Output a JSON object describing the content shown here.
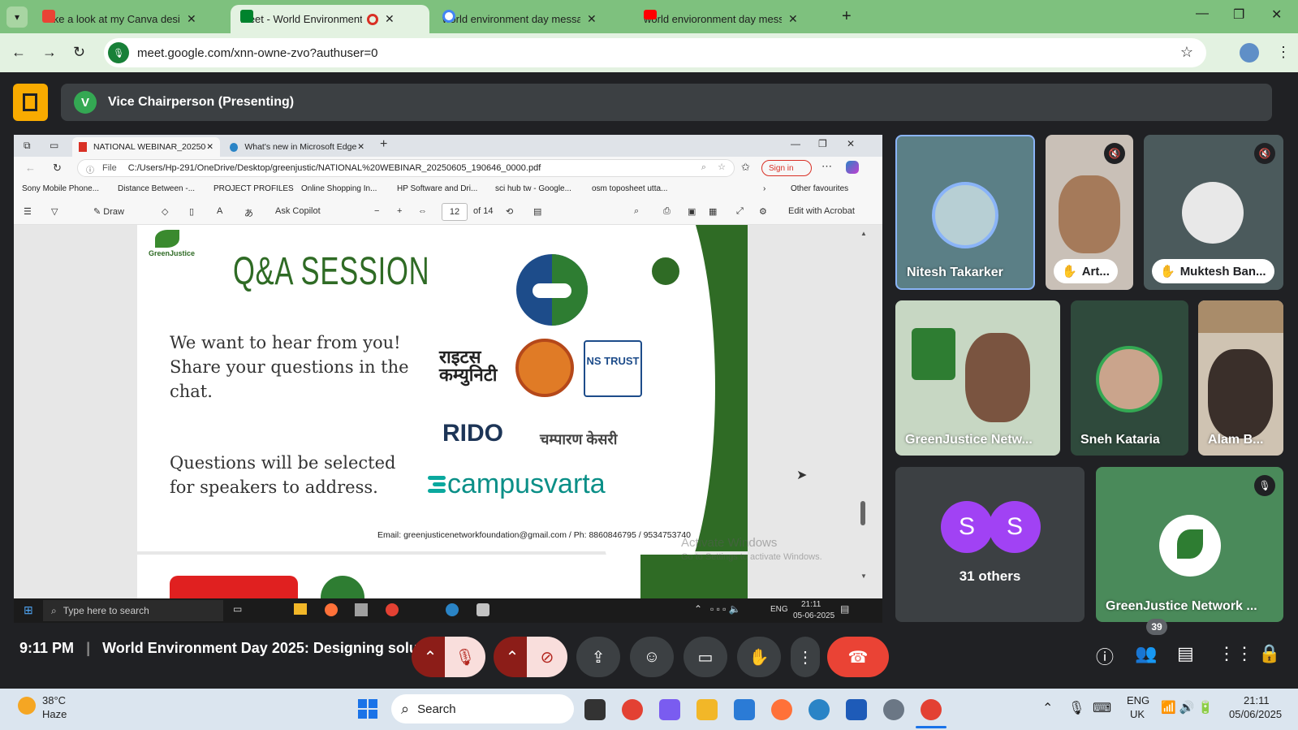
{
  "browser": {
    "tabs": [
      {
        "title": "Take a look at my Canva design",
        "icon": "gmail-icon",
        "color": "#ea4335"
      },
      {
        "title": "Meet - World Environment",
        "icon": "meet-icon",
        "color": "#00832d"
      },
      {
        "title": "world environment day messag",
        "icon": "google-icon",
        "color": "#4285f4"
      },
      {
        "title": "world envioronment day messa",
        "icon": "youtube-icon",
        "color": "#ff0000"
      }
    ],
    "url": "meet.google.com/xnn-owne-zvo?authuser=0"
  },
  "meet": {
    "presenter_initial": "V",
    "presenter_label": "Vice Chairperson (Presenting)",
    "time": "9:11 PM",
    "meeting_title": "World Environment Day 2025: Designing soluti...",
    "participant_count": "39",
    "others_label": "31 others",
    "others_initials": [
      "S",
      "S"
    ],
    "tiles": [
      {
        "name": "Nitesh Takarker"
      },
      {
        "name": "Art..."
      },
      {
        "name": "Muktesh Ban..."
      },
      {
        "name": "GreenJustice Netw..."
      },
      {
        "name": "Sneh Kataria"
      },
      {
        "name": "Alam B..."
      },
      {
        "name": "GreenJustice Network ..."
      }
    ]
  },
  "shared": {
    "edge_tabs": [
      "NATIONAL WEBINAR_20250605_",
      "What's new in Microsoft Edge"
    ],
    "file_label": "File",
    "file_path": "C:/Users/Hp-291/OneDrive/Desktop/greenjustic/NATIONAL%20WEBINAR_20250605_190646_0000.pdf",
    "sign_in": "Sign in",
    "favorites": [
      "Sony Mobile Phone...",
      "Distance Between -...",
      "PROJECT PROFILES",
      "Online Shopping In...",
      "HP Software and Dri...",
      "sci hub tw - Google...",
      "osm toposheet utta..."
    ],
    "other_favourites": "Other favourites",
    "pdf_tools": {
      "draw": "Draw",
      "ask_copilot": "Ask Copilot",
      "page": "12",
      "of_pages": "of 14",
      "edit_acrobat": "Edit with Acrobat"
    },
    "slide": {
      "org_name": "GreenJustice",
      "heading": "Q&A SESSION",
      "body1": "We want to hear from you! Share your questions in the chat.",
      "body2": "Questions will be selected for speakers to address.",
      "email_line": "Email: greenjusticenetworkfoundation@gmail.com / Ph: 8860846795 / 9534753740",
      "logos": [
        "राइटस कम्युनिटी",
        "NS TRUST",
        "RIDO",
        "चम्पारण केसरी",
        "campusvarta"
      ]
    },
    "watermark1": "Activate Windows",
    "watermark2": "Go to Settings to activate Windows.",
    "inner_search": "Type here to search",
    "inner_lang": "ENG",
    "inner_time": "21:11",
    "inner_date": "05-06-2025"
  },
  "taskbar": {
    "weather_temp": "38°C",
    "weather_desc": "Haze",
    "search": "Search",
    "lang": "ENG",
    "region": "UK",
    "time": "21:11",
    "date": "05/06/2025"
  }
}
